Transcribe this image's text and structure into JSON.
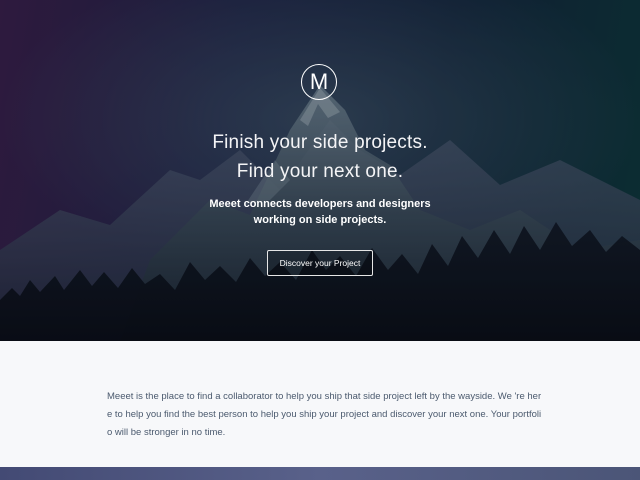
{
  "hero": {
    "logo_letter": "M",
    "headline_line1": "Finish your side projects.",
    "headline_line2": "Find your next one.",
    "subtext": "Meeet connects developers and designers working on side projects.",
    "cta_label": "Discover your Project"
  },
  "about": {
    "text": "Meeet is the place to find a collaborator to help you ship that side project left by the wayside. We 're here to help you find the best person to help you ship your project and discover your next one. Your portfolio will be stronger in no time."
  },
  "colors": {
    "hero_purple": "#3a1f4a",
    "hero_teal": "#0c3a3a",
    "about_bg": "#f7f8fa",
    "about_text": "#4b5a6e",
    "footer_band": "#4f5780"
  }
}
